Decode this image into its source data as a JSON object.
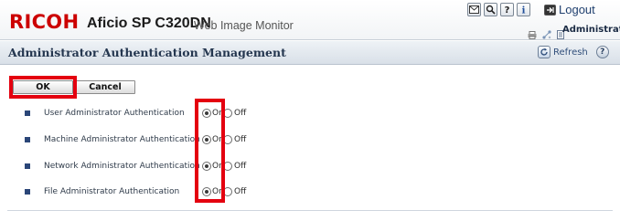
{
  "header": {
    "brand": "RICOH",
    "product": "Aficio SP C320DN",
    "app_name": "Web Image Monitor",
    "logout_label": "Logout",
    "user_label": "Administrator"
  },
  "page": {
    "title": "Administrator Authentication Management",
    "refresh_label": "Refresh"
  },
  "actions": {
    "ok_label": "OK",
    "cancel_label": "Cancel"
  },
  "settings": [
    {
      "label": "User Administrator Authentication",
      "separator": ":",
      "on_label": "On",
      "off_label": "Off",
      "selected": "On"
    },
    {
      "label": "Machine Administrator Authentication",
      "separator": ":",
      "on_label": "On",
      "off_label": "Off",
      "selected": "On"
    },
    {
      "label": "Network Administrator Authentication",
      "separator": ":",
      "on_label": "On",
      "off_label": "Off",
      "selected": "On"
    },
    {
      "label": "File Administrator Authentication",
      "separator": ":",
      "on_label": "On",
      "off_label": "Off",
      "selected": "On"
    }
  ],
  "icons": {
    "top_toolbar": [
      "mail-icon",
      "search-icon",
      "help-icon",
      "info-icon",
      "logout-icon"
    ],
    "status_bar": [
      "printer-icon",
      "network-icon",
      "document-icon"
    ]
  },
  "colors": {
    "brand_red": "#cc0000",
    "highlight_red": "#e4000f",
    "title_text": "#24364f",
    "bullet": "#2b4678"
  }
}
